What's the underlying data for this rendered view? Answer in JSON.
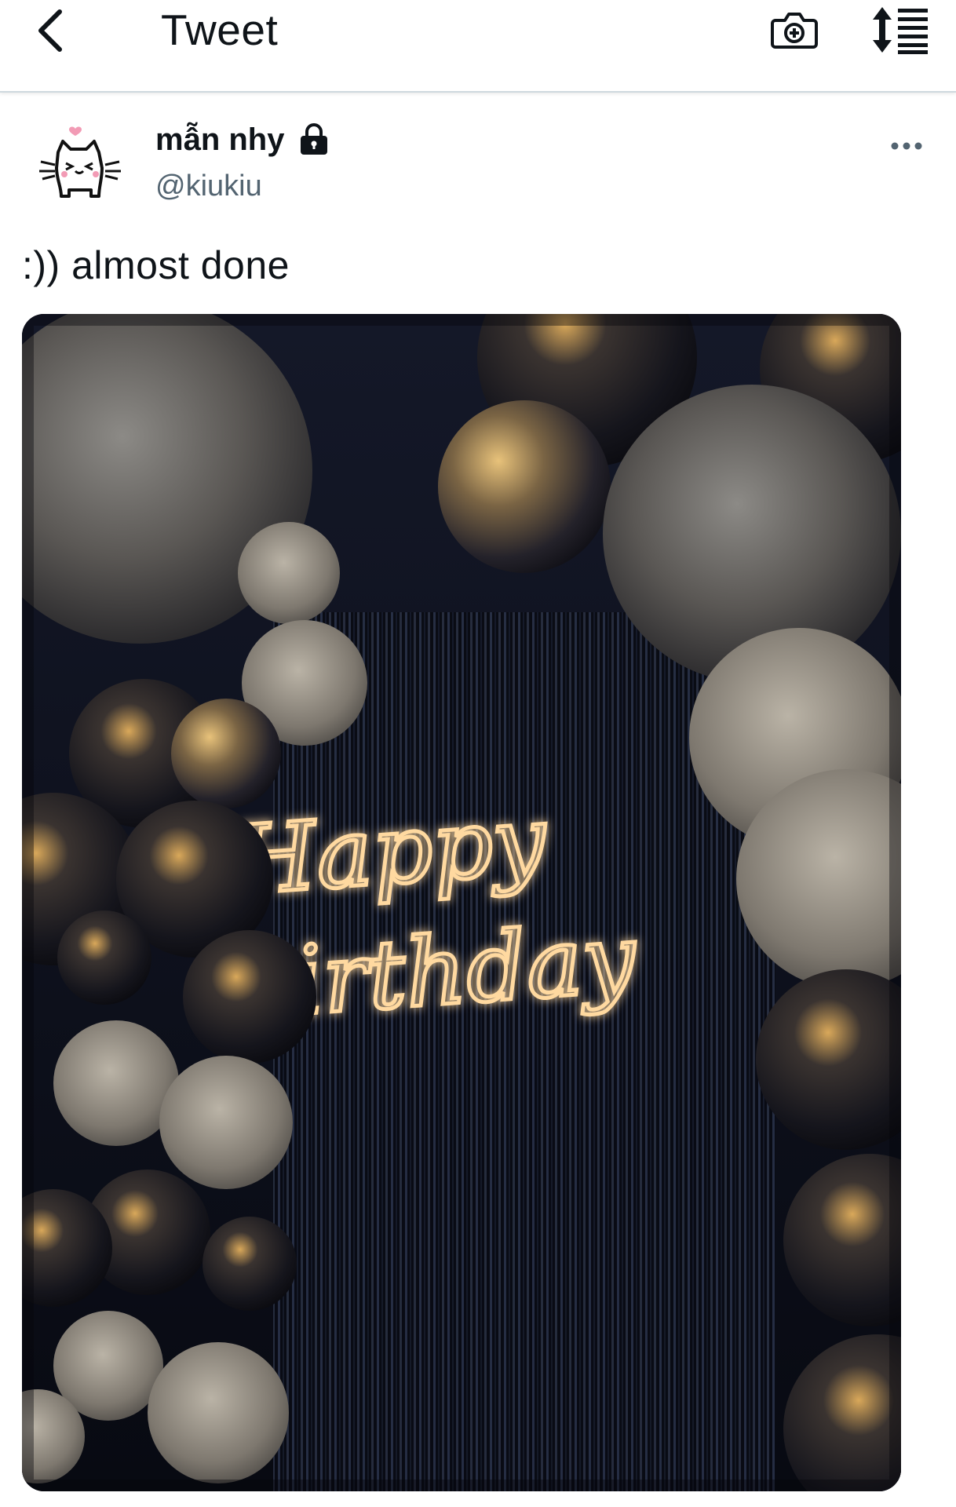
{
  "header": {
    "title": "Tweet",
    "back_icon": "chevron-left-icon",
    "camera_icon": "camera-plus-icon",
    "sort_icon": "sort-list-icon"
  },
  "tweet": {
    "display_name": "mẫn nhy",
    "handle": "@kiukiu",
    "protected_icon": "lock-icon",
    "more_icon": "more-horizontal-icon",
    "text": ":)) almost done",
    "media": {
      "sign_line_1": "Happy",
      "sign_line_2": "Birthday",
      "description_icon": "photo"
    }
  },
  "colors": {
    "text_primary": "#0f1419",
    "text_secondary": "#536471",
    "divider": "#cfd9de",
    "neon": "#ffd9a0"
  }
}
